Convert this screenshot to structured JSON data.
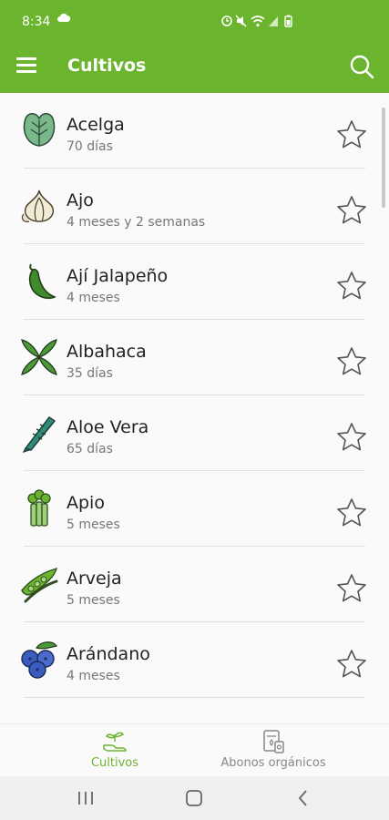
{
  "status_bar": {
    "time": "8:34"
  },
  "app_bar": {
    "title": "Cultivos",
    "menu_icon": "hamburger-menu-icon",
    "search_icon": "search-icon"
  },
  "crops": [
    {
      "name": "Acelga",
      "duration": "70 días",
      "icon": "chard-icon"
    },
    {
      "name": "Ajo",
      "duration": "4 meses y 2 semanas",
      "icon": "garlic-icon"
    },
    {
      "name": "Ají Jalapeño",
      "duration": "4 meses",
      "icon": "jalapeno-icon"
    },
    {
      "name": "Albahaca",
      "duration": "35 días",
      "icon": "basil-icon"
    },
    {
      "name": "Aloe Vera",
      "duration": "65 días",
      "icon": "aloe-vera-icon"
    },
    {
      "name": "Apio",
      "duration": "5 meses",
      "icon": "celery-icon"
    },
    {
      "name": "Arveja",
      "duration": "5 meses",
      "icon": "pea-icon"
    },
    {
      "name": "Arándano",
      "duration": "4 meses",
      "icon": "blueberry-icon"
    }
  ],
  "bottom_nav": {
    "cultivos_label": "Cultivos",
    "abonos_label": "Abonos orgánicos",
    "active": "Cultivos"
  },
  "colors": {
    "primary": "#6bb52e",
    "text": "#222222",
    "secondary_text": "#777777",
    "inactive_tab": "#888888"
  }
}
